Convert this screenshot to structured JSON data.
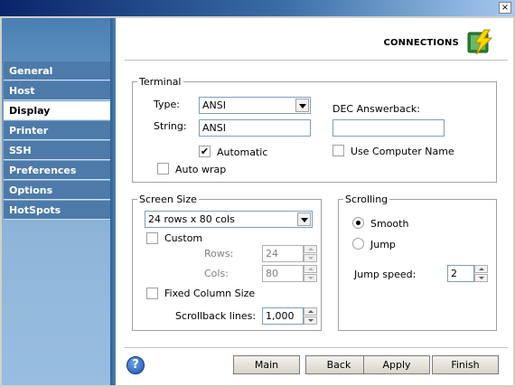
{
  "window": {
    "close_glyph": "×"
  },
  "header": {
    "title": "CONNECTIONS",
    "icon": "lightning-connections-icon"
  },
  "sidebar": {
    "items": [
      {
        "label": "General",
        "active": false
      },
      {
        "label": "Host",
        "active": false
      },
      {
        "label": "Display",
        "active": true
      },
      {
        "label": "Printer",
        "active": false
      },
      {
        "label": "SSH",
        "active": false
      },
      {
        "label": "Preferences",
        "active": false
      },
      {
        "label": "Options",
        "active": false
      },
      {
        "label": "HotSpots",
        "active": false
      }
    ]
  },
  "terminal": {
    "legend": "Terminal",
    "type_label": "Type:",
    "type_value": "ANSI",
    "string_label": "String:",
    "string_value": "ANSI",
    "automatic_label": "Automatic",
    "automatic_checked": true,
    "autowrap_label": "Auto wrap",
    "autowrap_checked": false,
    "dec_label": "DEC Answerback:",
    "dec_value": "",
    "use_computer_name_label": "Use Computer Name",
    "use_computer_name_checked": false
  },
  "screen_size": {
    "legend": "Screen Size",
    "selected": "24 rows x 80 cols",
    "custom_label": "Custom",
    "custom_checked": false,
    "rows_label": "Rows:",
    "rows_value": "24",
    "cols_label": "Cols:",
    "cols_value": "80",
    "fixed_column_label": "Fixed Column Size",
    "fixed_column_checked": false,
    "scrollback_label": "Scrollback lines:",
    "scrollback_value": "1,000"
  },
  "scrolling": {
    "legend": "Scrolling",
    "smooth_label": "Smooth",
    "smooth_selected": true,
    "jump_label": "Jump",
    "jump_selected": false,
    "jump_speed_label": "Jump speed:",
    "jump_speed_value": "2"
  },
  "footer": {
    "help_glyph": "?",
    "main_label": "Main",
    "back_label": "Back",
    "apply_label": "Apply",
    "finish_label": "Finish"
  },
  "colors": {
    "sidebar_item": "#4d7aa8",
    "sidebar_active": "#ffffff",
    "titlebar_start": "#0a246a",
    "titlebar_end": "#a6caf0"
  }
}
